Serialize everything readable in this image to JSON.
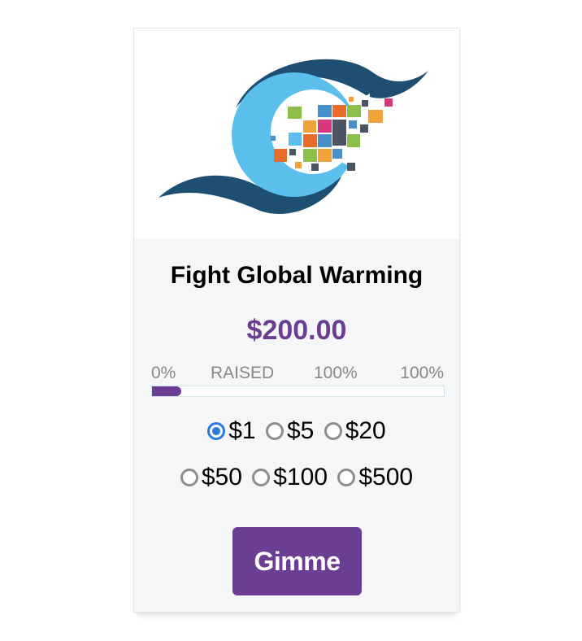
{
  "campaign": {
    "title": "Fight Global Warming",
    "amount": "$200.00"
  },
  "progress": {
    "label_start": "0%",
    "label_raised": "RAISED",
    "label_mid": "100%",
    "label_end": "100%",
    "fill_fraction": 0.1,
    "fill_color": "#6a3e92"
  },
  "donation_options": {
    "row1": [
      "$1",
      "$5",
      "$20"
    ],
    "row2": [
      "$50",
      "$100",
      "$500"
    ],
    "selected": "$1"
  },
  "submit": {
    "label": "Gimme"
  },
  "colors": {
    "accent": "#6a3e92",
    "radio_selected": "#2a7ae2",
    "logo_dark_blue": "#1f4e73",
    "logo_light_blue": "#5bbfee"
  },
  "icons": {
    "logo": "globe-pixel-swoosh-logo"
  }
}
